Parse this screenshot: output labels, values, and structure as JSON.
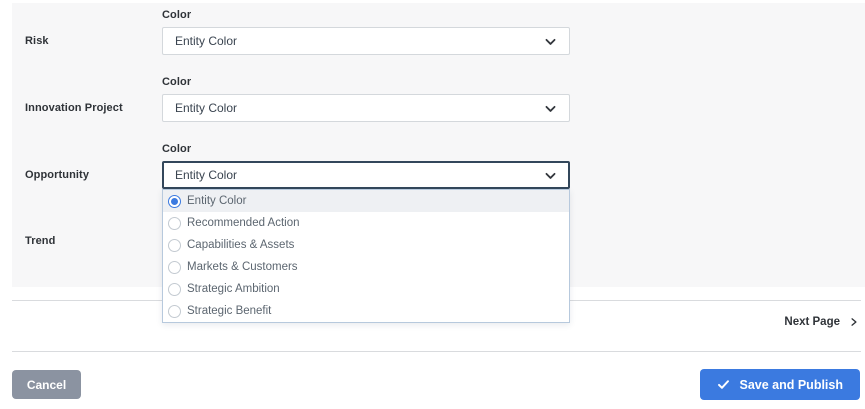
{
  "form": {
    "field_label": "Color",
    "rows": [
      {
        "entity": "Risk",
        "value": "Entity Color"
      },
      {
        "entity": "Innovation Project",
        "value": "Entity Color"
      },
      {
        "entity": "Opportunity",
        "value": "Entity Color"
      },
      {
        "entity": "Trend"
      }
    ],
    "open_dropdown": {
      "belongs_to": "Opportunity",
      "options": [
        {
          "label": "Entity Color",
          "selected": true
        },
        {
          "label": "Recommended Action",
          "selected": false
        },
        {
          "label": "Capabilities & Assets",
          "selected": false
        },
        {
          "label": "Markets & Customers",
          "selected": false
        },
        {
          "label": "Strategic Ambition",
          "selected": false
        },
        {
          "label": "Strategic Benefit",
          "selected": false
        }
      ]
    }
  },
  "pagination": {
    "next_label": "Next Page"
  },
  "footer": {
    "cancel_label": "Cancel",
    "save_label": "Save and Publish"
  },
  "colors": {
    "accent_blue": "#3b7ae0",
    "cancel_gray": "#8b93a1",
    "focus_border": "#33475b",
    "panel_background": "#f7f7f8",
    "dropdown_border": "#d4d8dc",
    "menu_border": "#b7c9dd",
    "selected_option_background": "#eef0f3"
  }
}
